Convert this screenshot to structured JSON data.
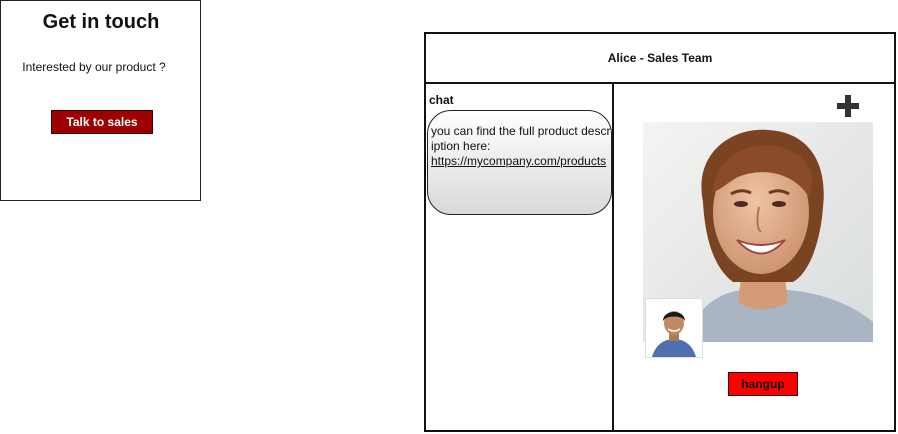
{
  "contact_card": {
    "title": "Get in touch",
    "subtitle": "Interested by our product ?",
    "cta_label": "Talk to sales"
  },
  "call": {
    "title": "Alice - Sales Team",
    "chat": {
      "label": "chat",
      "messages": [
        {
          "text": "you can find the full product description here:",
          "link": "https://mycompany.com/products"
        }
      ]
    },
    "add_icon": "plus-icon",
    "hangup_label": "hangup"
  },
  "colors": {
    "cta_bg": "#9c0000",
    "hangup_bg": "#ff0000",
    "border": "#111111"
  }
}
